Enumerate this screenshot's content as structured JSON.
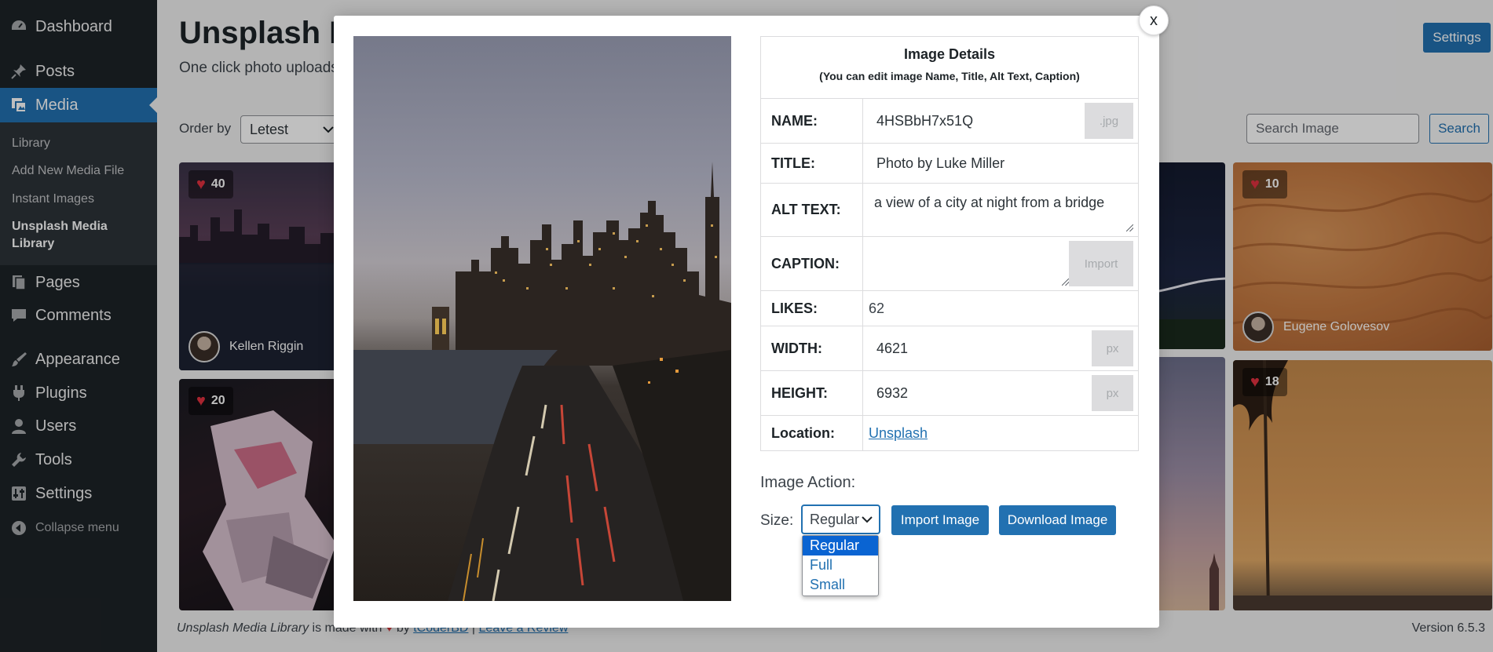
{
  "sidebar": {
    "items": [
      {
        "label": "Dashboard",
        "icon": "dashboard-icon"
      },
      {
        "label": "Posts",
        "icon": "pin-icon"
      },
      {
        "label": "Media",
        "icon": "media-icon"
      },
      {
        "label": "Pages",
        "icon": "pages-icon"
      },
      {
        "label": "Comments",
        "icon": "comment-icon"
      },
      {
        "label": "Appearance",
        "icon": "paintbrush-icon"
      },
      {
        "label": "Plugins",
        "icon": "plugin-icon"
      },
      {
        "label": "Users",
        "icon": "user-icon"
      },
      {
        "label": "Tools",
        "icon": "wrench-icon"
      },
      {
        "label": "Settings",
        "icon": "settings-icon"
      }
    ],
    "media_submenu": [
      "Library",
      "Add New Media File",
      "Instant Images",
      "Unsplash Media Library"
    ],
    "collapse_label": "Collapse menu"
  },
  "page": {
    "title": "Unsplash M",
    "subtitle": "One click photo uploads",
    "settings_label": "Settings",
    "order_label": "Order by",
    "order_value": "Letest",
    "search_placeholder": "Search Image",
    "search_label": "Search"
  },
  "gallery": [
    {
      "likes": "40",
      "author": "Kellen Riggin"
    },
    {
      "likes": "20",
      "author": ""
    },
    {
      "likes": "10",
      "author": "Eugene Golovesov"
    },
    {
      "likes": "18",
      "author": ""
    }
  ],
  "footer": {
    "plugin_name": "Unsplash Media Library",
    "made_with": "is made with",
    "by": "by",
    "author_link": "tCoderBD",
    "separator": "|",
    "review_link": "Leave a Review",
    "version": "Version 6.5.3"
  },
  "modal": {
    "close_label": "x",
    "details_title": "Image Details",
    "details_note": "(You can edit image Name, Title, Alt Text, Caption)",
    "fields": {
      "name": {
        "label": "NAME:",
        "value": "4HSBbH7x51Q",
        "suffix": ".jpg"
      },
      "title": {
        "label": "TITLE:",
        "value": "Photo by Luke Miller"
      },
      "alt": {
        "label": "ALT TEXT:",
        "value": "a view of a city at night from a bridge"
      },
      "caption": {
        "label": "CAPTION:",
        "value": "",
        "button": "Import"
      },
      "likes": {
        "label": "LIKES:",
        "value": "62"
      },
      "width": {
        "label": "WIDTH:",
        "value": "4621",
        "suffix": "px"
      },
      "height": {
        "label": "HEIGHT:",
        "value": "6932",
        "suffix": "px"
      },
      "location": {
        "label": "Location:",
        "value": "Unsplash"
      }
    },
    "action_title": "Image Action:",
    "size_label": "Size:",
    "size_value": "Regular",
    "size_options": [
      "Regular",
      "Full",
      "Small"
    ],
    "import_label": "Import Image",
    "download_label": "Download Image"
  },
  "colors": {
    "sidebar_bg": "#1d2327",
    "accent": "#2271b1",
    "heart": "#e0303f",
    "option_selected": "#0a64d2"
  }
}
